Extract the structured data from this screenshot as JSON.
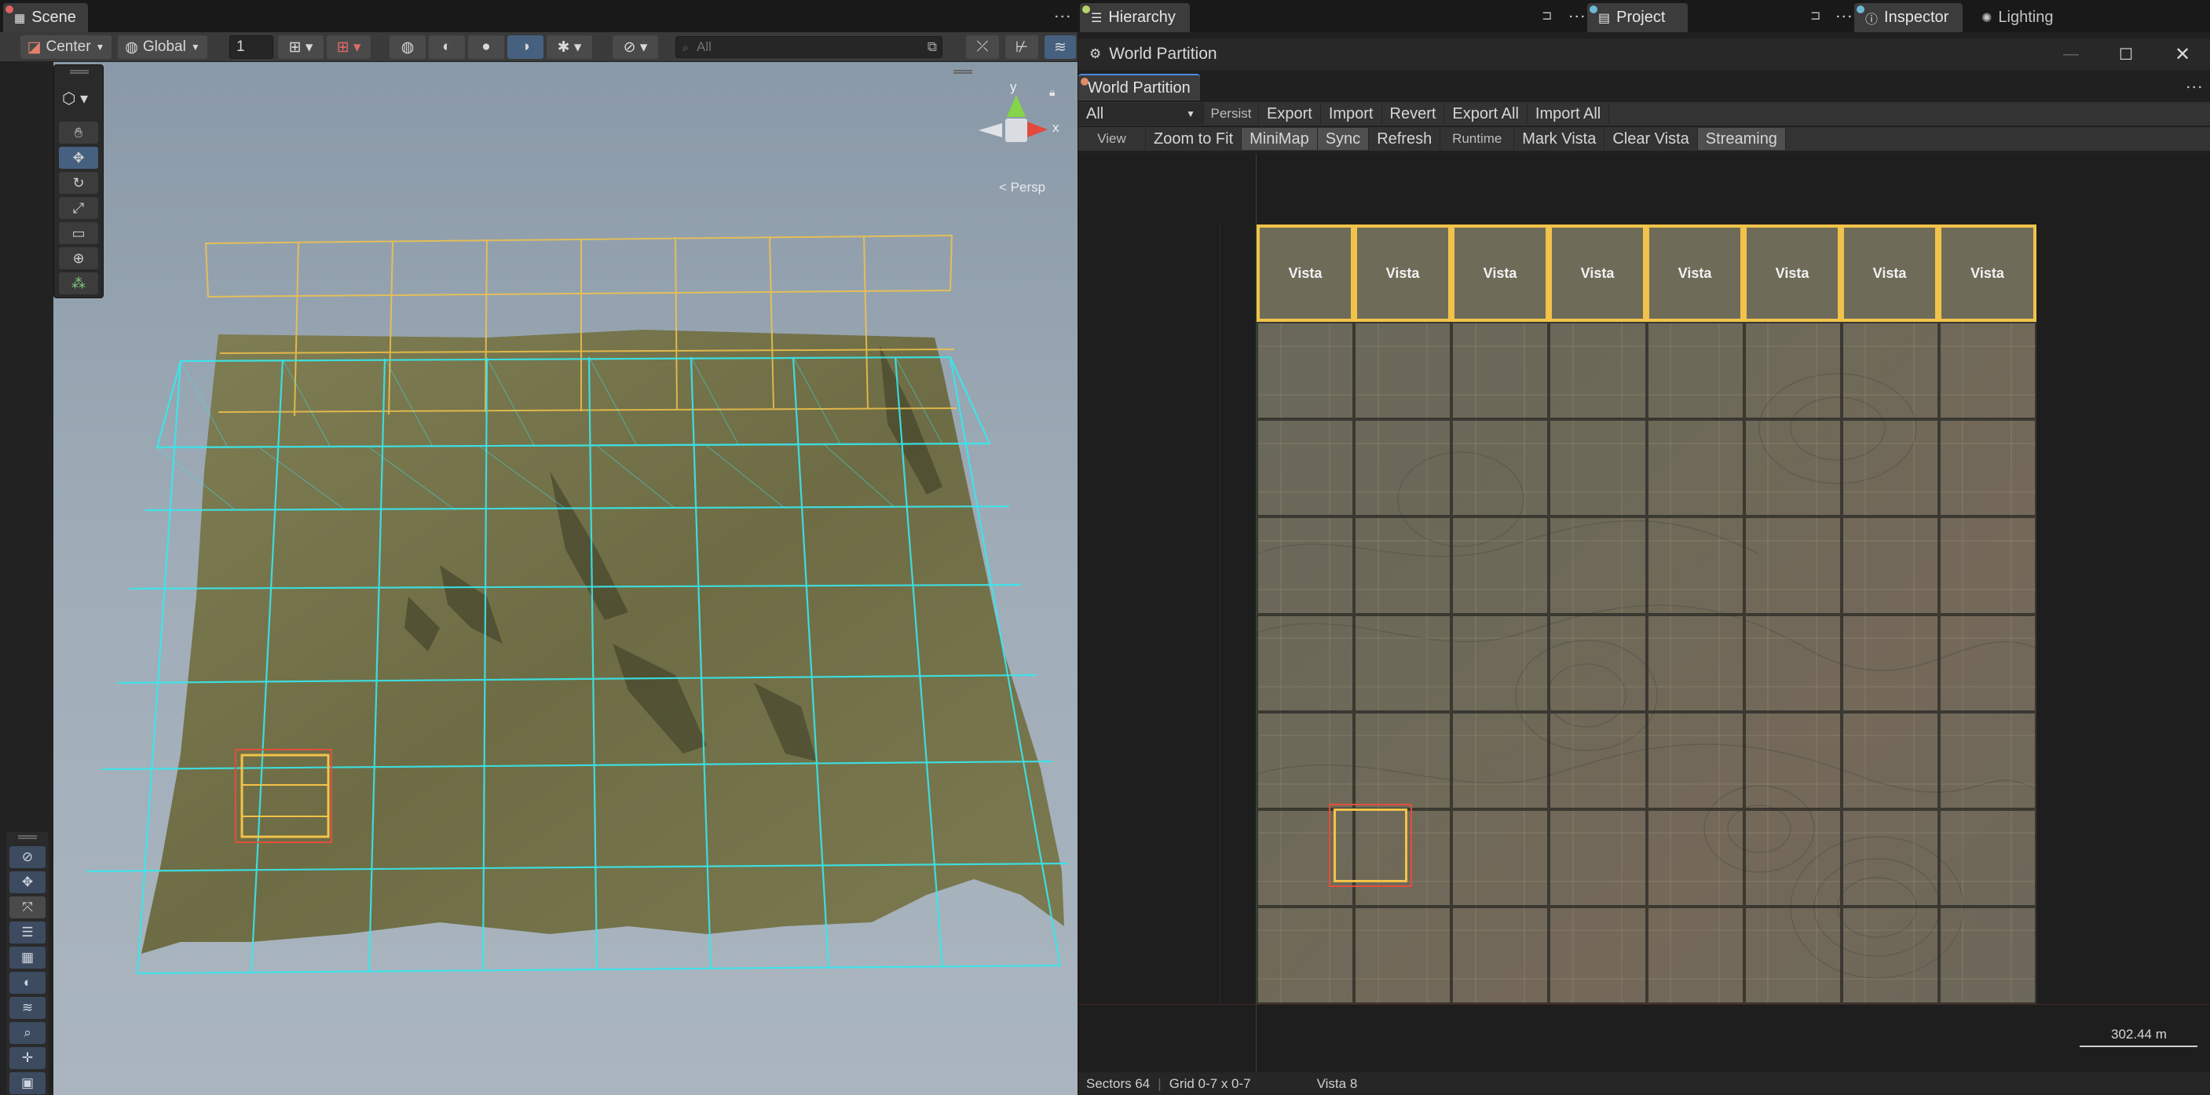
{
  "scene_panel": {
    "tab_label": "Scene",
    "toolbar": {
      "pivot_label": "Center",
      "space_label": "Global",
      "increment_value": "1",
      "search_placeholder": "All"
    },
    "gizmo": {
      "y_label": "y",
      "x_label": "x",
      "projection_label": "< Persp"
    }
  },
  "top_tabs": {
    "hierarchy": "Hierarchy",
    "project": "Project",
    "inspector": "Inspector",
    "lighting": "Lighting"
  },
  "world_partition": {
    "window_title": "World Partition",
    "tab_label": "World Partition",
    "toolbar1": {
      "filter_value": "All",
      "persist_label": "Persist",
      "buttons": [
        "Export",
        "Import",
        "Revert",
        "Export All",
        "Import All"
      ]
    },
    "toolbar2": {
      "view_label": "View",
      "view_buttons": [
        "Zoom to Fit",
        "MiniMap",
        "Sync",
        "Refresh"
      ],
      "runtime_label": "Runtime",
      "runtime_buttons": [
        "Mark Vista",
        "Clear Vista",
        "Streaming"
      ]
    },
    "grid": {
      "rows": 8,
      "cols": 8,
      "vista_cells": [
        "Vista",
        "Vista",
        "Vista",
        "Vista",
        "Vista",
        "Vista",
        "Vista",
        "Vista"
      ]
    },
    "scale_label": "302.44 m",
    "status": {
      "sectors": "Sectors 64",
      "grid": "Grid 0-7 x 0-7",
      "vista": "Vista 8"
    }
  },
  "colors": {
    "vista_border": "#f2c34a",
    "selection_red": "#e0503c",
    "wire_cyan": "#38e8ee",
    "terrain": "#7a7a4f",
    "accent_blue": "#46607f"
  }
}
